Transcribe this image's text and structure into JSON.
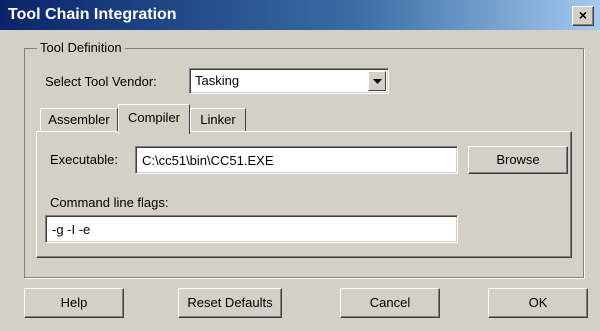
{
  "window": {
    "title": "Tool Chain Integration",
    "close_glyph": "×"
  },
  "group": {
    "legend": "Tool Definition"
  },
  "vendor": {
    "label": "Select Tool Vendor:",
    "value": "Tasking"
  },
  "tabs": [
    {
      "label": "Assembler"
    },
    {
      "label": "Compiler",
      "active": true
    },
    {
      "label": "Linker"
    }
  ],
  "compiler": {
    "executable_label": "Executable:",
    "executable_value": "C:\\cc51\\bin\\CC51.EXE",
    "browse_label": "Browse",
    "flags_label": "Command line flags:",
    "flags_value": "-g -I -e"
  },
  "buttons": {
    "help": "Help",
    "reset": "Reset Defaults",
    "cancel": "Cancel",
    "ok": "OK"
  }
}
